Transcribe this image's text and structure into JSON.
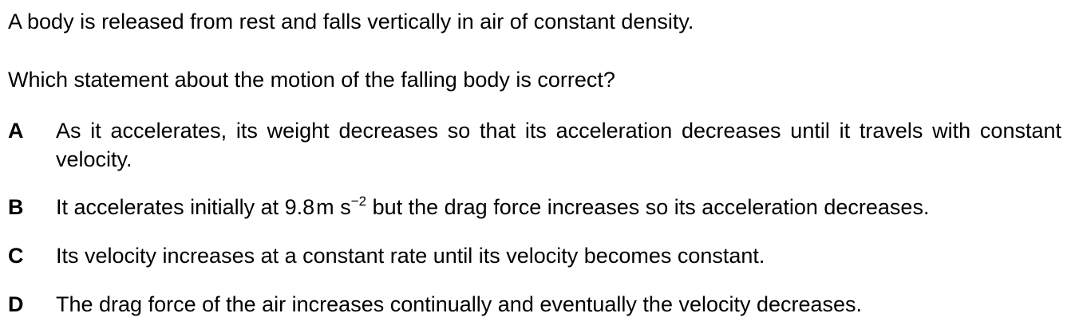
{
  "question": {
    "stem_line_1": "A body is released from rest and falls vertically in air of constant density.",
    "stem_line_2": "Which statement about the motion of the falling body is correct?"
  },
  "options": [
    {
      "letter": "A",
      "text": "As it accelerates, its weight decreases so that its acceleration decreases until it travels with constant velocity."
    },
    {
      "letter": "B",
      "text_before": "It accelerates initially at 9.8",
      "unit_m": "m",
      "unit_s": "s",
      "superscript": "−2",
      "text_after": " but the drag force increases so its acceleration decreases."
    },
    {
      "letter": "C",
      "text": "Its velocity increases at a constant rate until its velocity becomes constant."
    },
    {
      "letter": "D",
      "text": "The drag force of the air increases continually and eventually the velocity decreases."
    }
  ]
}
